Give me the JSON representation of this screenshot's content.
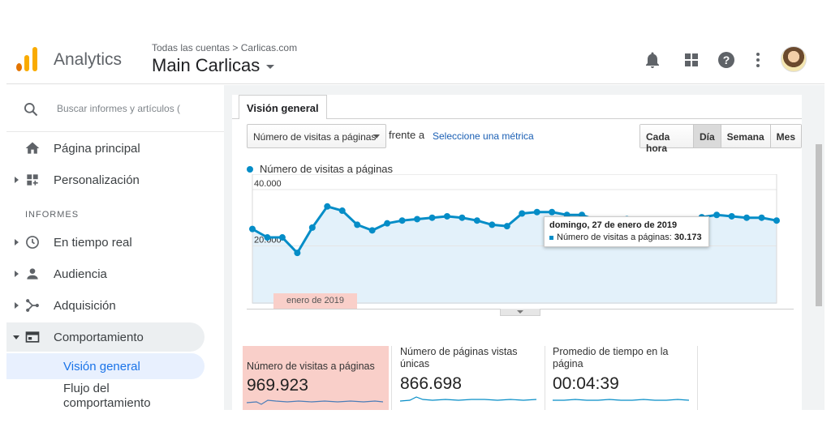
{
  "header": {
    "brand": "Analytics",
    "breadcrumb": "Todas las cuentas > Carlicas.com",
    "property": "Main Carlicas",
    "colors": {
      "logo_orange": "#f9ab00",
      "logo_dark": "#e37400"
    },
    "icons": [
      "bell-icon",
      "apps-grid-icon",
      "help-icon",
      "more-vert-icon"
    ]
  },
  "sidebar": {
    "search_placeholder": "Buscar informes y artículos (",
    "items": [
      {
        "label": "Página principal",
        "icon": "home-icon"
      },
      {
        "label": "Personalización",
        "icon": "dashboard-add-icon"
      }
    ],
    "section_label": "INFORMES",
    "reports": [
      {
        "label": "En tiempo real",
        "icon": "clock-icon"
      },
      {
        "label": "Audiencia",
        "icon": "person-icon"
      },
      {
        "label": "Adquisición",
        "icon": "acquisition-icon"
      },
      {
        "label": "Comportamiento",
        "icon": "behavior-icon"
      }
    ],
    "sub_items": [
      {
        "label": "Visión general"
      },
      {
        "label": "Flujo del comportamiento"
      }
    ]
  },
  "main": {
    "tab_label": "Visión general",
    "metric_select": "Número de visitas a páginas",
    "versus_label": "frente a",
    "select_metric_link": "Seleccione una métrica",
    "granularity": [
      "Cada hora",
      "Día",
      "Semana",
      "Mes"
    ],
    "granularity_selected": "Día",
    "legend_label": "Número de visitas a páginas",
    "tooltip": {
      "date": "domingo, 27 de enero de 2019",
      "label": "Número de visitas a páginas:",
      "value": "30.173"
    },
    "month_label": "enero de 2019"
  },
  "chart_data": {
    "type": "area",
    "y_ticks": [
      "40.000",
      "20.000"
    ],
    "ylim": [
      0,
      42000
    ],
    "series": [
      {
        "values": [
          26000,
          23000,
          23000,
          17500,
          26500,
          34000,
          32500,
          27500,
          25500,
          28000,
          29000,
          29500,
          30000,
          30500,
          30000,
          29000,
          27500,
          27000,
          31500,
          32000,
          32000,
          31000,
          31000,
          29000,
          28500,
          29500,
          29000,
          28500,
          28000,
          29000,
          30173,
          31000,
          30500,
          30000,
          30000,
          29000
        ]
      }
    ],
    "color": "#058dc7",
    "fill": "#e3f1fa"
  },
  "scorecards": [
    {
      "title": "Número de visitas a páginas",
      "value": "969.923",
      "highlight": true
    },
    {
      "title": "Número de páginas vistas únicas",
      "value": "866.698",
      "highlight": false
    },
    {
      "title": "Promedio de tiempo en la página",
      "value": "00:04:39",
      "highlight": false
    }
  ]
}
